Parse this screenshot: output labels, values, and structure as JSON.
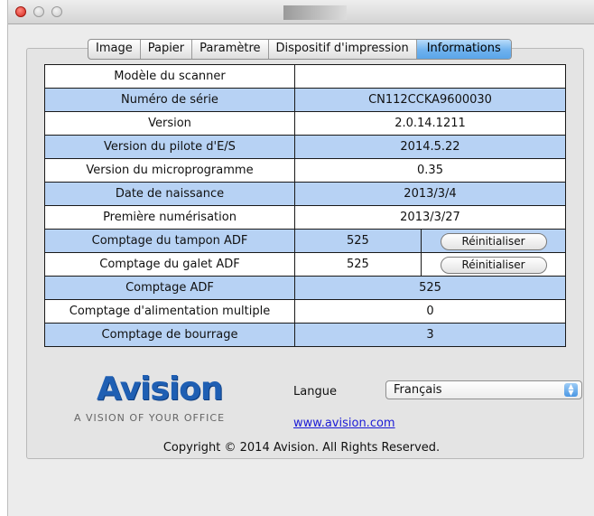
{
  "tabs": [
    {
      "label": "Image"
    },
    {
      "label": "Papier"
    },
    {
      "label": "Paramètre"
    },
    {
      "label": "Dispositif d'impression"
    },
    {
      "label": "Informations"
    }
  ],
  "info_rows": [
    {
      "label": "Modèle du scanner",
      "value": ""
    },
    {
      "label": "Numéro de série",
      "value": "CN112CCKA9600030"
    },
    {
      "label": "Version",
      "value": "2.0.14.1211"
    },
    {
      "label": "Version du pilote d'E/S",
      "value": "2014.5.22"
    },
    {
      "label": "Version du microprogramme",
      "value": "0.35"
    },
    {
      "label": "Date de naissance",
      "value": "2013/3/4"
    },
    {
      "label": "Première numérisation",
      "value": "2013/3/27"
    },
    {
      "label": "Comptage du tampon ADF",
      "value": "525",
      "button": "Réinitialiser"
    },
    {
      "label": "Comptage du galet ADF",
      "value": "525",
      "button": "Réinitialiser"
    },
    {
      "label": "Comptage ADF",
      "value": "525"
    },
    {
      "label": "Comptage d'alimentation multiple",
      "value": "0"
    },
    {
      "label": "Comptage de bourrage",
      "value": "3"
    }
  ],
  "logo": {
    "text": "Avision",
    "tagline": "A VISION OF YOUR OFFICE",
    "color": "#1f5fb3"
  },
  "language": {
    "label": "Langue",
    "selected": "Français"
  },
  "link": "www.avision.com",
  "copyright": "Copyright © 2014 Avision. All Rights Reserved.",
  "colors": {
    "row_highlight": "#b7d2f4",
    "tab_active": "#6fb2ee"
  }
}
